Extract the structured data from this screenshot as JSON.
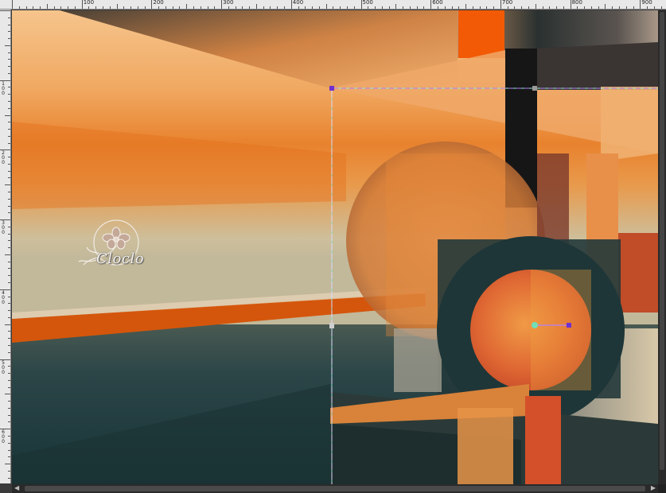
{
  "ruler": {
    "top_labels": [
      "100",
      "200",
      "300",
      "400",
      "500",
      "600",
      "700",
      "800",
      "900"
    ],
    "left_labels": [
      "100",
      "200",
      "300",
      "400",
      "500",
      "600"
    ]
  },
  "watermark": {
    "text": "Cloclo"
  },
  "colors": {
    "orange_light": "#f4b074",
    "orange": "#e87c2c",
    "burnt_orange": "#d45a0c",
    "teal_dark": "#1e3a3c",
    "beige": "#c8c0a0",
    "guide": "#b080ff"
  }
}
